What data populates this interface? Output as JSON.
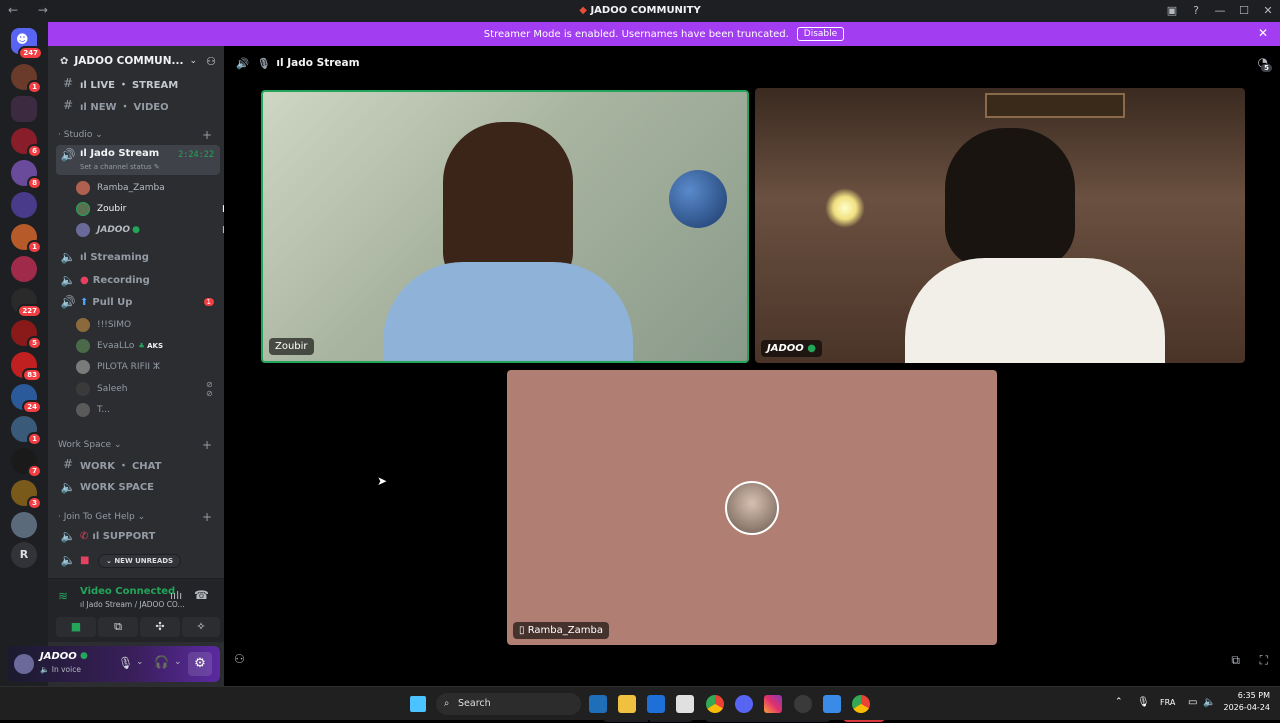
{
  "window": {
    "title": "JADOO COMMUNITY"
  },
  "banner": {
    "text": "Streamer Mode is enabled. Usernames have been truncated.",
    "action": "Disable"
  },
  "guilds": {
    "top_badge": "247",
    "badges": [
      "1",
      "6",
      "8",
      "1",
      "227",
      "5",
      "83",
      "24",
      "1",
      "7",
      "3"
    ],
    "extra_letter": "R"
  },
  "server": {
    "name": "JADOO COMMUN..."
  },
  "channels": {
    "text1": "ıl LIVE ・ STREAM",
    "text2": "ıl NEW ・ VIDEO",
    "cat_studio": "Studio",
    "voice_active": "ıl Jado Stream",
    "voice_time": "2:24:22",
    "status_hint": "Set a channel status",
    "members_active": [
      "Ramba_Zamba",
      "Zoubir",
      "JADOO"
    ],
    "voice2": "ıl Streaming",
    "voice3": "Recording",
    "voice4": "Pull Up",
    "voice4_badge": "1",
    "members_pullup": [
      "!!!SIMO",
      "EvaaLLo",
      "PILOTA RIFII ⵣ",
      "Saleeh",
      "T..."
    ],
    "aks_tag": "AKS",
    "cat_work": "Work Space",
    "work1": "WORK ・ CHAT",
    "work2": "WORK SPACE",
    "cat_help": "Join To Get Help",
    "help1": "ıl SUPPORT",
    "new_unreads": "NEW UNREADS"
  },
  "voice_panel": {
    "status": "Video Connected",
    "location": "ıl Jado Stream / JADOO CO..."
  },
  "user_panel": {
    "name": "JADOO",
    "status": "In voice"
  },
  "main": {
    "header": "ıl Jado Stream",
    "notif_count": "5"
  },
  "tiles": {
    "t1": "Zoubir",
    "t2": "JADOO",
    "t3": "Ramba_Zamba"
  },
  "taskbar": {
    "search": "Search",
    "lang": "FRA",
    "time": "6:35 PM",
    "date": "2026-04-24"
  }
}
